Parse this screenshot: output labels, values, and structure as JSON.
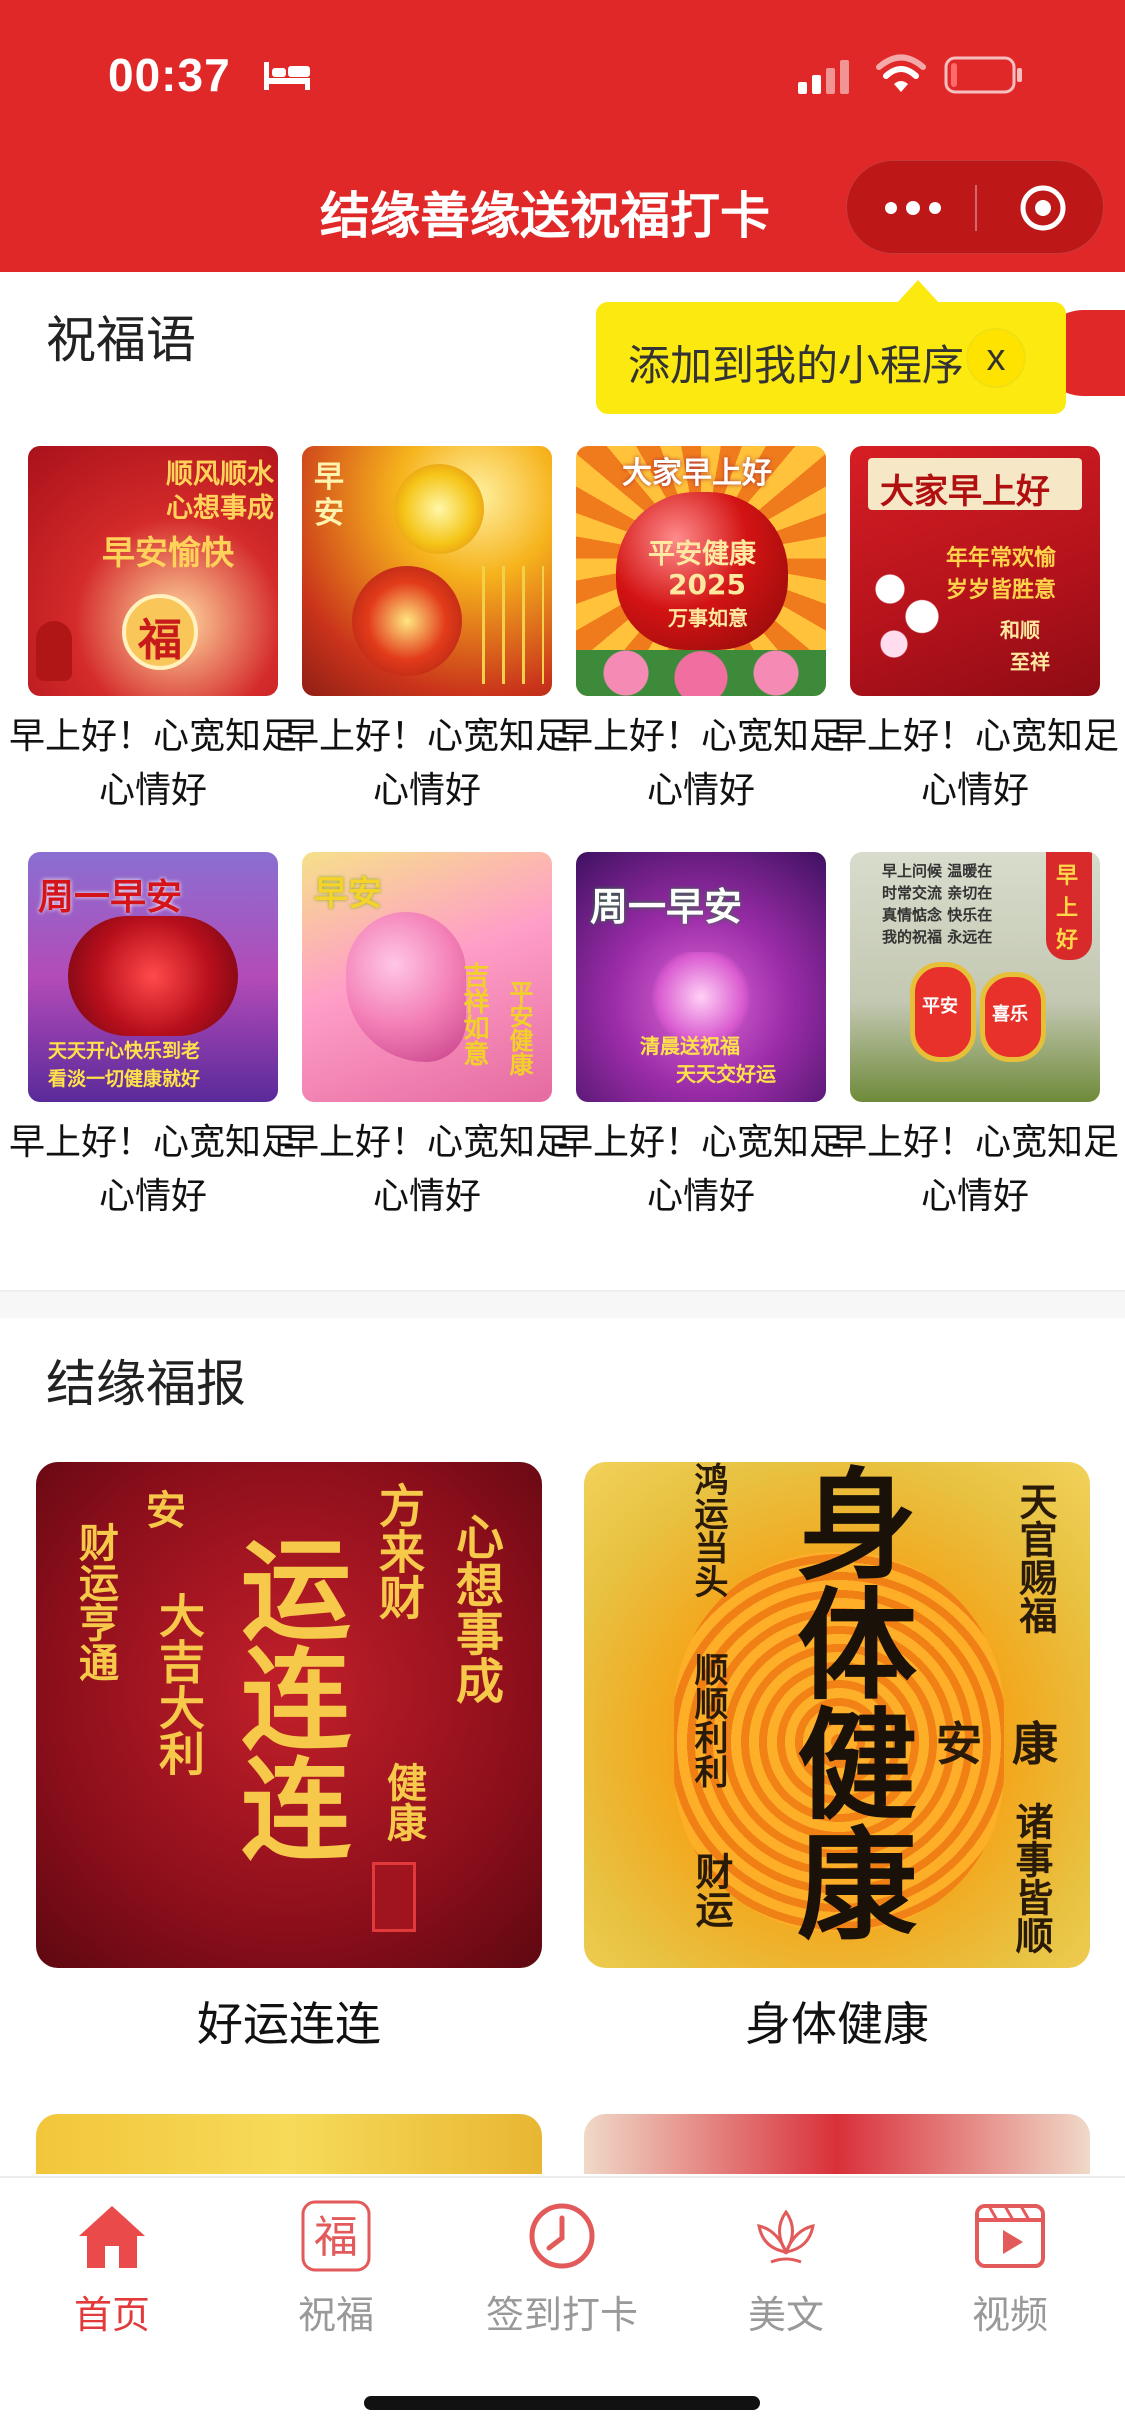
{
  "status_bar": {
    "time": "00:37"
  },
  "nav": {
    "title": "结缘善缘送祝福打卡"
  },
  "tooltip": {
    "text": "添加到我的小程序",
    "close_label": "x"
  },
  "greetings": {
    "title": "祝福语",
    "items": [
      {
        "caption": "早上好！心宽知足心情好",
        "image_texts": [
          "顺风顺水",
          "心想事成",
          "早安愉快",
          "福"
        ]
      },
      {
        "caption": "早上好！心宽知足心情好",
        "image_texts": [
          "早",
          "安"
        ]
      },
      {
        "caption": "早上好！心宽知足心情好",
        "image_texts": [
          "大家早上好",
          "平安健康",
          "2025",
          "万事如意"
        ]
      },
      {
        "caption": "早上好！心宽知足心情好",
        "image_texts": [
          "大家早上好",
          "年年常欢愉",
          "岁岁皆胜意",
          "和顺",
          "至祥"
        ]
      },
      {
        "caption": "早上好！心宽知足心情好",
        "image_texts": [
          "周一早安",
          "天天开心快乐到老",
          "看淡一切健康就好"
        ]
      },
      {
        "caption": "早上好！心宽知足心情好",
        "image_texts": [
          "早安",
          "吉祥如意",
          "平安健康"
        ]
      },
      {
        "caption": "早上好！心宽知足心情好",
        "image_texts": [
          "周一早安",
          "清晨送祝福",
          "天天交好运"
        ]
      },
      {
        "caption": "早上好！心宽知足心情好",
        "image_texts": [
          "早上问候 温暖在",
          "时常交流 亲切在",
          "真情惦念 快乐在",
          "我的祝福 永远在",
          "早",
          "上",
          "好",
          "平安",
          "喜乐"
        ]
      }
    ]
  },
  "fortune": {
    "title": "结缘福报",
    "items": [
      {
        "caption": "好运连连",
        "image_texts": [
          "财运亨通",
          "大吉大利",
          "运连连",
          "方来财",
          "心想事成",
          "健康",
          "安"
        ]
      },
      {
        "caption": "身体健康",
        "image_texts": [
          "身体健康",
          "鸿运当头",
          "顺顺利利",
          "天官赐福",
          "安康",
          "诸事皆顺",
          "财运"
        ]
      }
    ]
  },
  "tabs": [
    {
      "label": "首页",
      "icon": "home-icon",
      "active": true
    },
    {
      "label": "祝福",
      "icon": "fu-icon",
      "active": false
    },
    {
      "label": "签到打卡",
      "icon": "clock-icon",
      "active": false
    },
    {
      "label": "美文",
      "icon": "lotus-icon",
      "active": false
    },
    {
      "label": "视频",
      "icon": "video-icon",
      "active": false
    }
  ],
  "colors": {
    "brand_red": "#e12828",
    "tooltip_yellow": "#fce910",
    "tab_active": "#e23a3a",
    "tab_inactive": "#999999"
  }
}
